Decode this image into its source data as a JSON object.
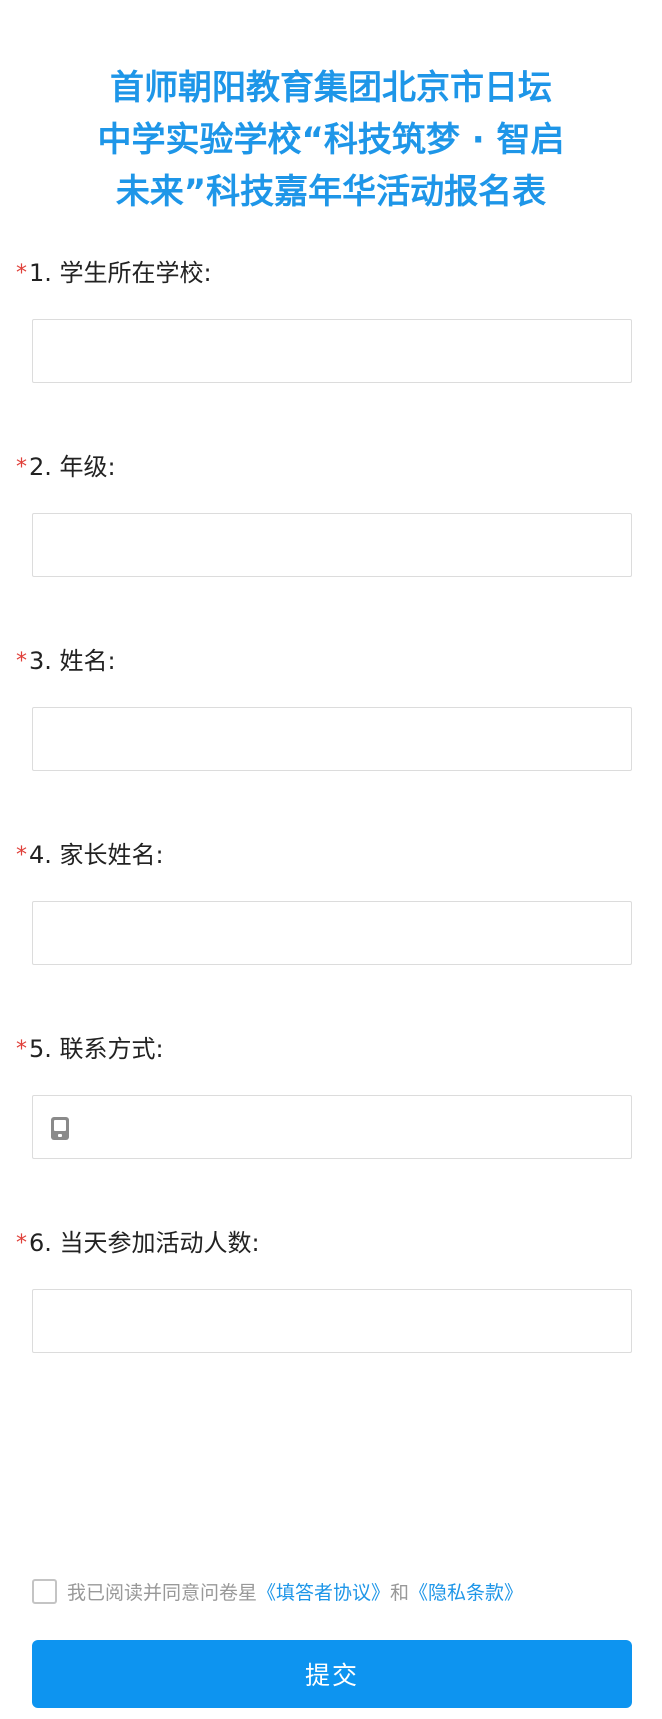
{
  "title_lines": [
    "首师朝阳教育集团北京市日坛",
    "中学实验学校“科技筑梦 · 智启",
    "未来”科技嘉年华活动报名表"
  ],
  "required_mark": "*",
  "questions": [
    {
      "label": "1. 学生所在学校:",
      "value": "",
      "placeholder": ""
    },
    {
      "label": "2. 年级:",
      "value": "",
      "placeholder": ""
    },
    {
      "label": "3. 姓名:",
      "value": "",
      "placeholder": ""
    },
    {
      "label": "4. 家长姓名:",
      "value": "",
      "placeholder": ""
    },
    {
      "label": "5. 联系方式:",
      "value": "",
      "placeholder": "",
      "icon": "phone-icon"
    },
    {
      "label": "6. 当天参加活动人数:",
      "value": "",
      "placeholder": ""
    }
  ],
  "agreement": {
    "checked": false,
    "prefix": "我已阅读并同意问卷星",
    "link1": "《填答者协议》",
    "connector": "和",
    "link2": "《隐私条款》"
  },
  "submit_label": "提交",
  "colors": {
    "title": "#1e96e8",
    "required": "#e0403a",
    "link": "#1e96e8",
    "submit_bg": "#0d94f0"
  }
}
